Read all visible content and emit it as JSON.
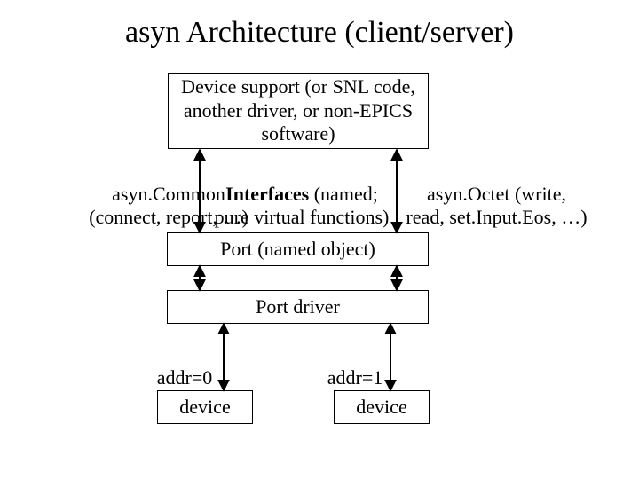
{
  "title": "asyn Architecture (client/server)",
  "boxes": {
    "client": "Device support (or SNL code, another driver, or non-EPICS software)",
    "port": "Port (named object)",
    "portdriver": "Port driver",
    "device0": "device",
    "device1": "device"
  },
  "labels": {
    "asyncommon_l1": "asyn.Common",
    "asyncommon_l2": "(connect, report, …)",
    "interfaces_name": "Interfaces",
    "interfaces_rest": " (named;",
    "interfaces_l2": "pure virtual functions)",
    "asynoctet_l1": "asyn.Octet (write,",
    "asynoctet_l2": "read, set.Input.Eos, …)",
    "addr0": "addr=0",
    "addr1": "addr=1"
  }
}
